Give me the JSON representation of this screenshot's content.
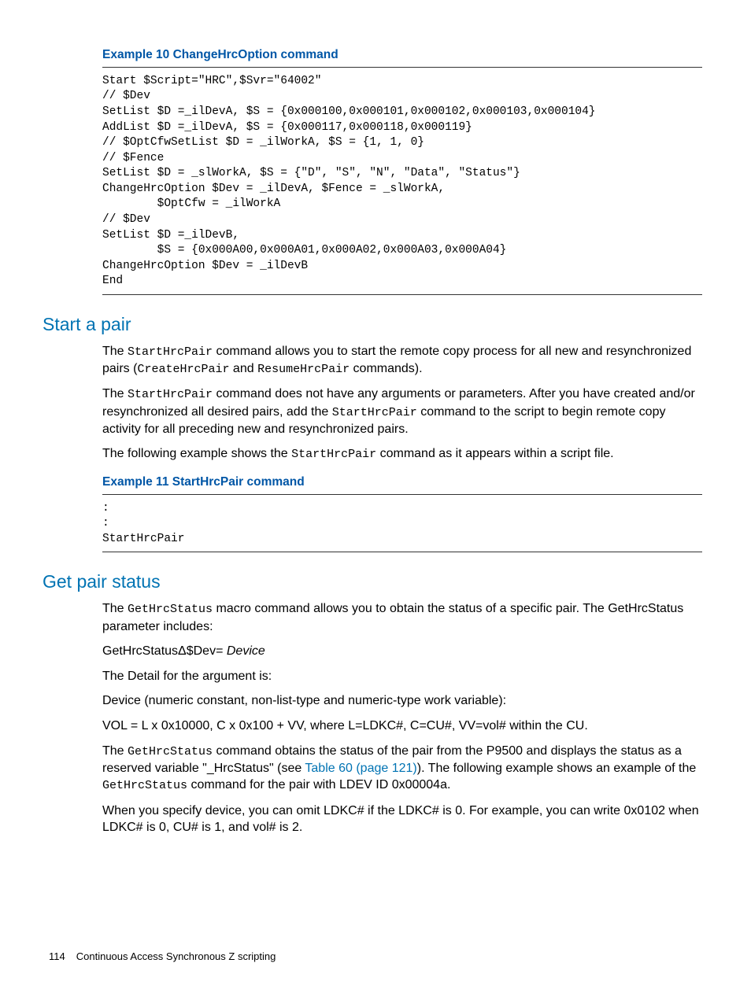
{
  "example10": {
    "title": "Example 10 ChangeHrcOption command",
    "code": "Start $Script=\"HRC\",$Svr=\"64002\"\n// $Dev\nSetList $D =_ilDevA, $S = {0x000100,0x000101,0x000102,0x000103,0x000104}\nAddList $D =_ilDevA, $S = {0x000117,0x000118,0x000119}\n// $OptCfwSetList $D = _ilWorkA, $S = {1, 1, 0}\n// $Fence\nSetList $D = _slWorkA, $S = {\"D\", \"S\", \"N\", \"Data\", \"Status\"}\nChangeHrcOption $Dev = _ilDevA, $Fence = _slWorkA,\n        $OptCfw = _ilWorkA\n// $Dev\nSetList $D =_ilDevB,\n        $S = {0x000A00,0x000A01,0x000A02,0x000A03,0x000A04}\nChangeHrcOption $Dev = _ilDevB\nEnd"
  },
  "section1": {
    "heading": "Start a pair",
    "p1a": "The ",
    "p1b": "StartHrcPair",
    "p1c": " command allows you to start the remote copy process for all new and resynchronized pairs (",
    "p1d": "CreateHrcPair",
    "p1e": " and ",
    "p1f": "ResumeHrcPair",
    "p1g": " commands).",
    "p2a": "The ",
    "p2b": "StartHrcPair",
    "p2c": " command does not have any arguments or parameters. After you have created and/or resynchronized all desired pairs, add the ",
    "p2d": "StartHrcPair",
    "p2e": " command to the script to begin remote copy activity for all preceding new and resynchronized pairs.",
    "p3a": "The following example shows the ",
    "p3b": "StartHrcPair",
    "p3c": " command as it appears within a script file."
  },
  "example11": {
    "title": "Example 11 StartHrcPair command",
    "code": ":\n:\nStartHrcPair"
  },
  "section2": {
    "heading": "Get pair status",
    "p1a": "The ",
    "p1b": "GetHrcStatus",
    "p1c": " macro command allows you to obtain the status of a specific pair. The GetHrcStatus parameter includes:",
    "p2a": "GetHrcStatusΔ$Dev= ",
    "p2b": "Device",
    "p3": "The Detail for the argument is:",
    "p4": "Device (numeric constant, non-list-type and numeric-type work variable):",
    "p5": "VOL = L x 0x10000, C x 0x100 + VV, where L=LDKC#, C=CU#, VV=vol# within the CU.",
    "p6a": "The ",
    "p6b": "GetHrcStatus",
    "p6c": " command obtains the status of the pair from the P9500 and displays the status as a reserved variable \"_HrcStatus\" (see ",
    "p6d": "Table 60 (page 121)",
    "p6e": "). The following example shows an example of the ",
    "p6f": "GetHrcStatus",
    "p6g": " command for the pair with LDEV ID 0x00004a.",
    "p7": "When you specify device, you can omit LDKC# if the LDKC# is 0. For example, you can write 0x0102 when LDKC# is 0, CU# is 1, and vol# is 2."
  },
  "footer": {
    "page": "114",
    "chapter": "Continuous Access Synchronous Z scripting"
  }
}
